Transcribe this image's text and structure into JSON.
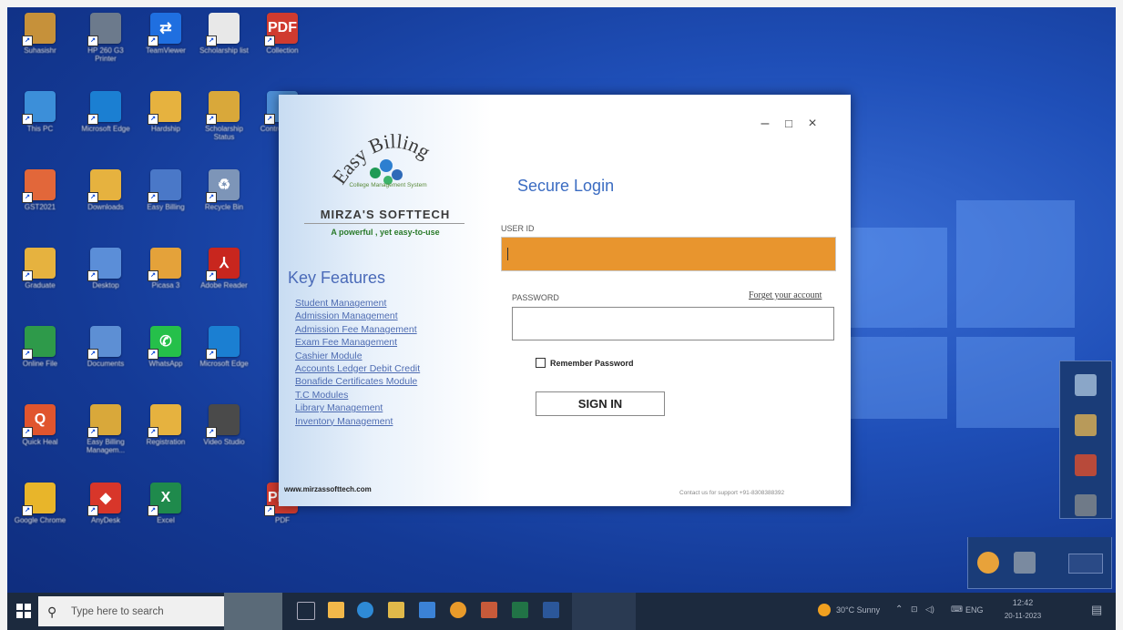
{
  "desktop": {
    "icons": [
      {
        "label": "Suhasishr",
        "color": "#c6913a",
        "glyph": ""
      },
      {
        "label": "HP 260 G3 Printer",
        "color": "#6c7a8c",
        "glyph": ""
      },
      {
        "label": "TeamViewer",
        "color": "#1f6fe0",
        "glyph": "⇄"
      },
      {
        "label": "Scholarship list",
        "color": "#e8e8e8",
        "glyph": ""
      },
      {
        "label": "Collection",
        "color": "#d03b2f",
        "glyph": "PDF"
      },
      {
        "label": "This PC",
        "color": "#3c8fd9",
        "glyph": ""
      },
      {
        "label": "Microsoft Edge",
        "color": "#1b7fd2",
        "glyph": ""
      },
      {
        "label": "Hardship",
        "color": "#e6b23f",
        "glyph": ""
      },
      {
        "label": "Scholarship Status",
        "color": "#d9a83a",
        "glyph": ""
      },
      {
        "label": "Control Panel",
        "color": "#4e8fd6",
        "glyph": ""
      },
      {
        "label": "GST2021",
        "color": "#e2673a",
        "glyph": ""
      },
      {
        "label": "Downloads",
        "color": "#e6b23f",
        "glyph": ""
      },
      {
        "label": "Easy Billing",
        "color": "#4a78c8",
        "glyph": ""
      },
      {
        "label": "Recycle Bin",
        "color": "#7d95b8",
        "glyph": "♻"
      },
      {
        "label": "Graduate",
        "color": "#e6b23f",
        "glyph": ""
      },
      {
        "label": "Desktop",
        "color": "#5b8ed8",
        "glyph": ""
      },
      {
        "label": "Picasa 3",
        "color": "#e4a23a",
        "glyph": ""
      },
      {
        "label": "Adobe Reader",
        "color": "#c8261e",
        "glyph": "⅄"
      },
      {
        "label": "Online File",
        "color": "#2e9a4a",
        "glyph": ""
      },
      {
        "label": "Documents",
        "color": "#5d8fd4",
        "glyph": ""
      },
      {
        "label": "WhatsApp",
        "color": "#25c04a",
        "glyph": "✆"
      },
      {
        "label": "Microsoft Edge",
        "color": "#1b7fd2",
        "glyph": ""
      },
      {
        "label": "Quick Heal",
        "color": "#e0552e",
        "glyph": "Q"
      },
      {
        "label": "Easy Billing Managem...",
        "color": "#d9a83a",
        "glyph": ""
      },
      {
        "label": "Registration",
        "color": "#e6b23f",
        "glyph": ""
      },
      {
        "label": "Video Studio",
        "color": "#4a4a4a",
        "glyph": ""
      },
      {
        "label": "Google Chrome",
        "color": "#e8b52a",
        "glyph": ""
      },
      {
        "label": "AnyDesk",
        "color": "#d8362a",
        "glyph": "◆"
      },
      {
        "label": "Excel",
        "color": "#1f8a4c",
        "glyph": "X"
      },
      {
        "label": "PDF",
        "color": "#d03b2f",
        "glyph": "PDF"
      }
    ]
  },
  "login": {
    "logo_text": "Easy Billing",
    "logo_sub": "College Management System",
    "brand": "MIRZA'S SOFTTECH",
    "tagline": "A powerful , yet easy-to-use",
    "features_title": "Key Features",
    "features": [
      "Student Management",
      "Admission Management",
      "Admission Fee Management",
      "Exam Fee Management",
      "Cashier Module",
      "Accounts  Ledger  Debit  Credit",
      "Bonafide Certificates Module",
      "T.C Modules",
      "Library Management",
      "Inventory Management"
    ],
    "website": "www.mirzassofttech.com",
    "window_controls": {
      "minimize": "–",
      "maximize": "□",
      "close": "×"
    },
    "title": "Secure Login",
    "user_label": "USER ID",
    "user_value": "",
    "password_label": "PASSWORD",
    "forgot": "Forget your account",
    "remember": "Remember Password",
    "signin": "SIGN IN",
    "support": "Contact us for support +91-8308388392"
  },
  "taskbar": {
    "search_placeholder": "Type here to search",
    "weather": "30°C  Sunny",
    "language": "ENG",
    "time": "12:42",
    "date": "20-11-2023"
  },
  "colors": {
    "accent": "#3b6cc2",
    "input_focus": "#e8952e"
  }
}
